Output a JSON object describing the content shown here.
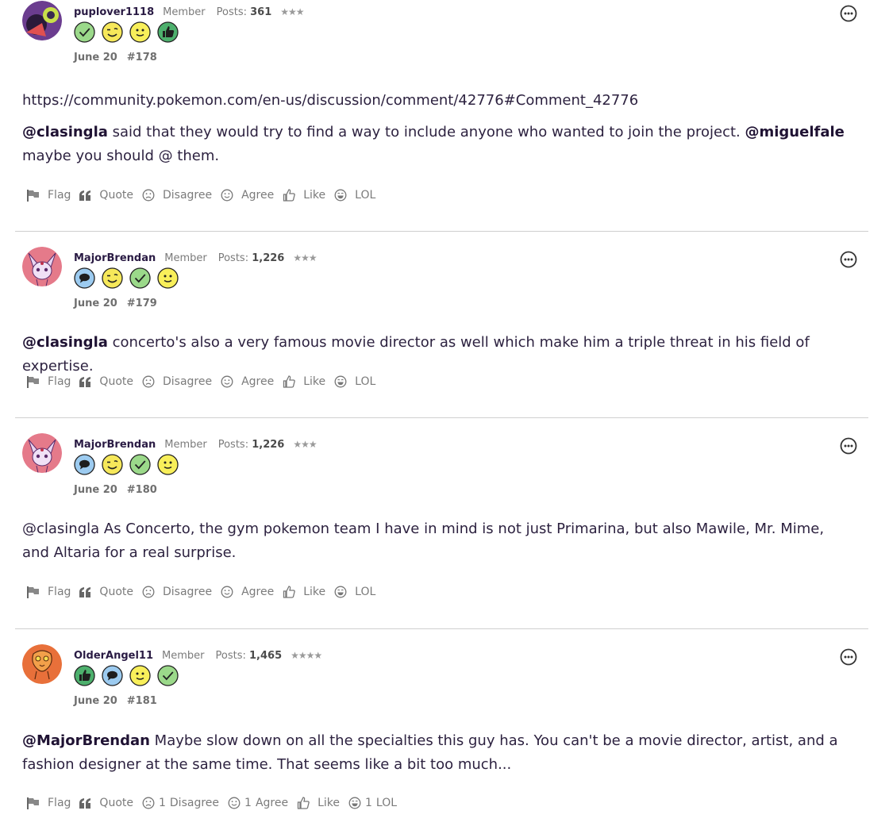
{
  "posts": [
    {
      "username": "puplover1118",
      "role": "Member",
      "posts_label": "Posts:",
      "post_count": "361",
      "rank": "★★★",
      "badges": [
        "check-badge-icon",
        "wink-badge-icon",
        "smile-badge-icon",
        "thumbs-up-badge-icon"
      ],
      "date": "June 20",
      "number": "#178",
      "body": [
        {
          "text": "https://community.pokemon.com/en-us/discussion/comment/42776#Comment_42776"
        },
        {
          "mention1": "@clasingla",
          "text1": " said that they would try to find a way to include anyone who wanted to join the project. ",
          "mention2": "@miguelfale",
          "text2": " maybe you should @ them."
        }
      ],
      "reactions": [
        {
          "label": "Flag",
          "count": ""
        },
        {
          "label": "Quote",
          "count": ""
        },
        {
          "label": "Disagree",
          "count": ""
        },
        {
          "label": "Agree",
          "count": ""
        },
        {
          "label": "Like",
          "count": ""
        },
        {
          "label": "LOL",
          "count": ""
        }
      ]
    },
    {
      "username": "MajorBrendan",
      "role": "Member",
      "posts_label": "Posts:",
      "post_count": "1,226",
      "rank": "★★★",
      "badges": [
        "comment-badge-icon",
        "wink-badge-icon",
        "check-badge-icon",
        "smile-badge-icon"
      ],
      "date": "June 20",
      "number": "#179",
      "body": [
        {
          "mention1": "@clasingla",
          "text1": " concerto's also a very famous movie director as well which make him a triple threat in his field of expertise."
        }
      ],
      "reactions": [
        {
          "label": "Flag",
          "count": ""
        },
        {
          "label": "Quote",
          "count": ""
        },
        {
          "label": "Disagree",
          "count": ""
        },
        {
          "label": "Agree",
          "count": ""
        },
        {
          "label": "Like",
          "count": ""
        },
        {
          "label": "LOL",
          "count": ""
        }
      ]
    },
    {
      "username": "MajorBrendan",
      "role": "Member",
      "posts_label": "Posts:",
      "post_count": "1,226",
      "rank": "★★★",
      "badges": [
        "comment-badge-icon",
        "wink-badge-icon",
        "check-badge-icon",
        "smile-badge-icon"
      ],
      "date": "June 20",
      "number": "#180",
      "body": [
        {
          "text": "@clasingla As Concerto, the gym pokemon team I have in mind is not just Primarina, but also Mawile, Mr. Mime, and Altaria for a real surprise."
        }
      ],
      "reactions": [
        {
          "label": "Flag",
          "count": ""
        },
        {
          "label": "Quote",
          "count": ""
        },
        {
          "label": "Disagree",
          "count": ""
        },
        {
          "label": "Agree",
          "count": ""
        },
        {
          "label": "Like",
          "count": ""
        },
        {
          "label": "LOL",
          "count": ""
        }
      ]
    },
    {
      "username": "OlderAngel11",
      "role": "Member",
      "posts_label": "Posts:",
      "post_count": "1,465",
      "rank": "★★★★",
      "badges": [
        "thumbs-up-badge-icon",
        "comment-badge-icon",
        "smile-badge-icon",
        "check-badge-icon"
      ],
      "date": "June 20",
      "number": "#181",
      "body": [
        {
          "mention1": "@MajorBrendan",
          "text1": " Maybe slow down on all the specialties this guy has. You can't be a movie director, artist, and a fashion designer at the same time. That seems like a bit too much..."
        }
      ],
      "reactions": [
        {
          "label": "Flag",
          "count": ""
        },
        {
          "label": "Quote",
          "count": ""
        },
        {
          "label": "Disagree",
          "count": "1"
        },
        {
          "label": "Agree",
          "count": "1"
        },
        {
          "label": "Like",
          "count": ""
        },
        {
          "label": "LOL",
          "count": "1"
        }
      ]
    }
  ]
}
